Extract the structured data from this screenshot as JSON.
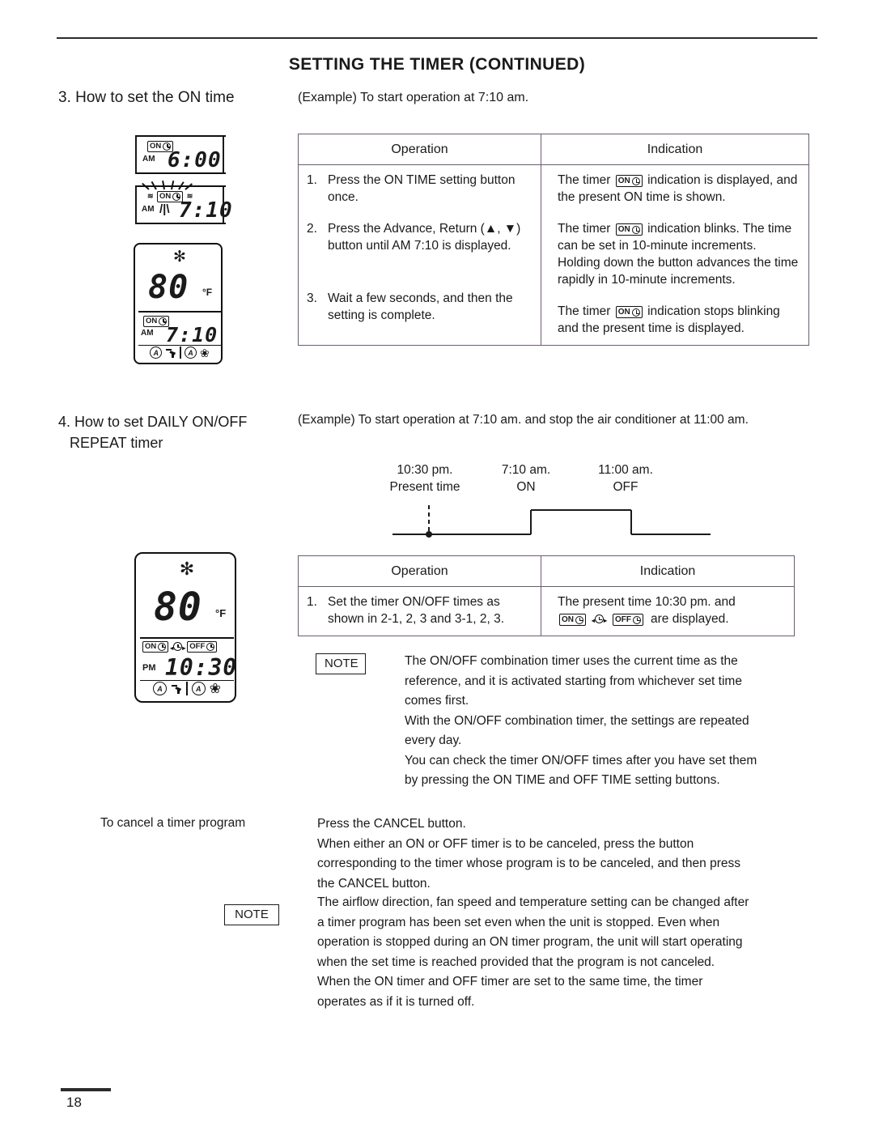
{
  "header": {
    "title": "SETTING THE TIMER (CONTINUED)"
  },
  "section3": {
    "heading": "3. How to set the ON time",
    "example": "(Example) To start operation at 7:10 am.",
    "lcds": [
      {
        "name": "lcd-on-time-6-00",
        "ampm": "AM",
        "badge": "ON",
        "time": "6:00",
        "blinking": "false"
      },
      {
        "name": "lcd-on-time-7-10-blinking",
        "ampm": "AM",
        "badge": "ON",
        "time": "7:10",
        "blinking": "true"
      },
      {
        "name": "lcd-full-display-on-timer",
        "mode_icon": "snowflake",
        "temperature": "80",
        "unit": "°F",
        "ampm": "AM",
        "badge": "ON",
        "time": "7:10",
        "bottom_icons": [
          "auto-swing",
          "airflow-vane",
          "auto-fan",
          "fan"
        ]
      }
    ],
    "table": {
      "columns": [
        "Operation",
        "Indication"
      ],
      "rows": [
        {
          "num": "1.",
          "operation": "Press the ON TIME setting button once.",
          "indication_pre": "The timer",
          "indication_badge": "ON",
          "indication_post": "indication is displayed, and the present ON time is shown."
        },
        {
          "num": "2.",
          "operation": "Press the Advance, Return (▲, ▼) button until AM 7:10 is displayed.",
          "indication_pre": "The timer",
          "indication_badge": "ON",
          "indication_post": "indication blinks. The time can be set in 10-minute increments. Holding down the button advances the time rapidly in 10-minute increments."
        },
        {
          "num": "3.",
          "operation": "Wait a few seconds, and then the setting is complete.",
          "indication_pre": "The timer",
          "indication_badge": "ON",
          "indication_post": "indication stops blinking and the present time is displayed."
        }
      ]
    }
  },
  "section4": {
    "heading_line1": "4. How to set DAILY ON/OFF",
    "heading_line2": "REPEAT timer",
    "example": "(Example) To start operation at 7:10 am. and stop the air conditioner at 11:00 am.",
    "timing_diagram": {
      "present_time_label": "10:30 pm.",
      "present_time_sub": "Present time",
      "on_time_label": "7:10 am.",
      "on_sub": "ON",
      "off_time_label": "11:00 am.",
      "off_sub": "OFF"
    },
    "lcd": {
      "name": "lcd-full-display-daily-repeat",
      "mode_icon": "snowflake",
      "temperature": "80",
      "unit": "°F",
      "badges": [
        "ON",
        "REPEAT",
        "OFF"
      ],
      "ampm": "PM",
      "time": "10:30",
      "bottom_icons": [
        "auto-swing",
        "airflow-vane",
        "auto-fan",
        "fan"
      ]
    },
    "table": {
      "columns": [
        "Operation",
        "Indication"
      ],
      "rows": [
        {
          "num": "1.",
          "operation": "Set the timer ON/OFF times as shown in 2-1, 2, 3 and 3-1, 2, 3.",
          "indication_pre": "The present time 10:30 pm. and",
          "indication_post": "are displayed."
        }
      ]
    },
    "note1": {
      "label": "NOTE",
      "lines": [
        "The ON/OFF combination timer uses the current time as the",
        "reference, and it is activated starting from whichever set time",
        "comes first.",
        "With the ON/OFF combination timer, the settings are repeated",
        "every day.",
        "You can check the timer ON/OFF times after you have set them",
        "by pressing the ON TIME and OFF TIME setting buttons."
      ]
    }
  },
  "cancel": {
    "label": "To cancel a timer program",
    "lines": [
      "Press the CANCEL button.",
      "When either an ON or OFF timer is to be canceled, press the button",
      "corresponding to the timer whose program is to be canceled, and then press",
      "the CANCEL button."
    ]
  },
  "note2": {
    "label": "NOTE",
    "lines": [
      "The airflow direction, fan speed and temperature setting can be changed after",
      "a timer program has been set even when the unit is stopped. Even when",
      "operation is stopped during an ON timer program, the unit will start operating",
      "when the set time is reached provided that the program is not canceled.",
      "When the ON timer and OFF timer are set to the same time, the timer",
      "operates as if it is turned off."
    ]
  },
  "footer": {
    "page_number": "18"
  },
  "icons": {
    "snowflake": "✻",
    "fan": "❀",
    "triangle_up": "▲",
    "triangle_down": "▼",
    "arrow_left": "◂",
    "arrow_right": "▸"
  },
  "colors": {
    "ink": "#1a1a1a",
    "rule": "#2b2b2b",
    "table_border": "#6b5b72",
    "paper": "#ffffff"
  }
}
